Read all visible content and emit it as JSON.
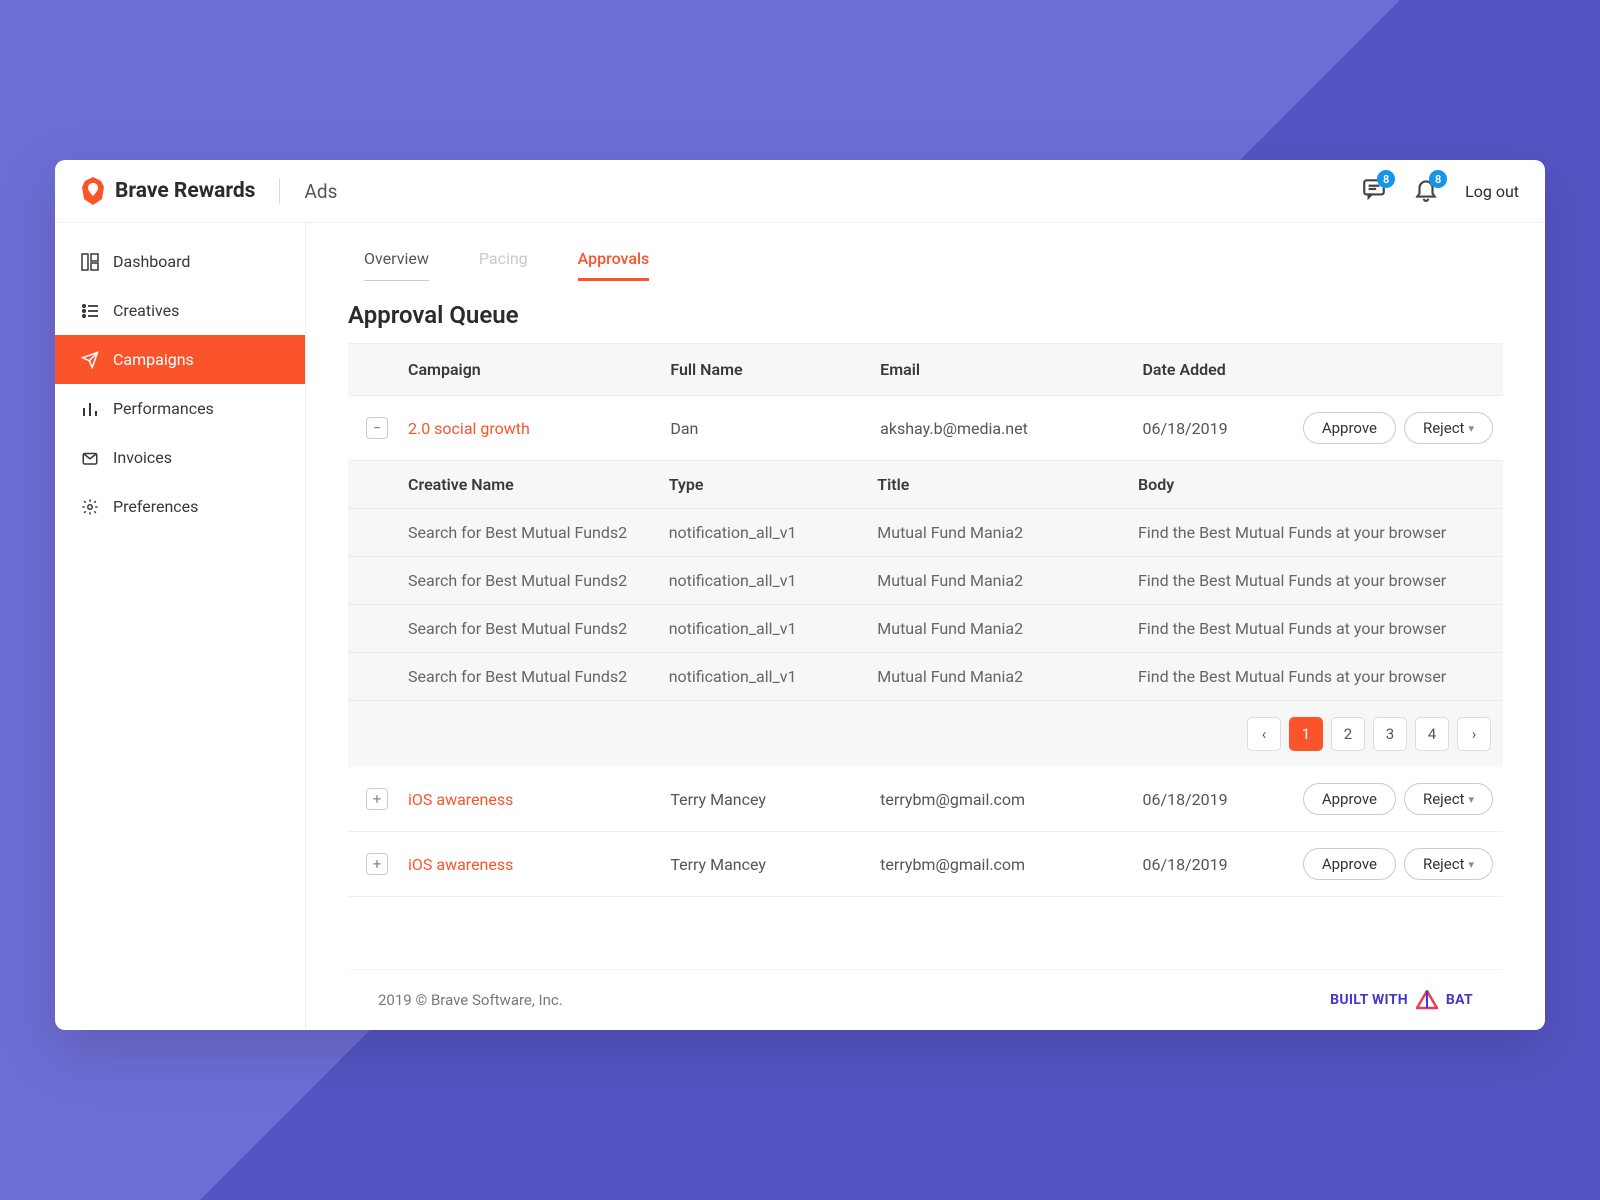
{
  "header": {
    "brand_title": "Brave Rewards",
    "brand_sub": "Ads",
    "chat_badge": "8",
    "bell_badge": "8",
    "logout_label": "Log out"
  },
  "sidebar": {
    "items": [
      {
        "label": "Dashboard"
      },
      {
        "label": "Creatives"
      },
      {
        "label": "Campaigns"
      },
      {
        "label": "Performances"
      },
      {
        "label": "Invoices"
      },
      {
        "label": "Preferences"
      }
    ]
  },
  "tabs": {
    "overview": "Overview",
    "pacing": "Pacing",
    "approvals": "Approvals"
  },
  "page_title": "Approval Queue",
  "table": {
    "headers": {
      "campaign": "Campaign",
      "full_name": "Full Name",
      "email": "Email",
      "date_added": "Date Added"
    },
    "rows": [
      {
        "expand": "−",
        "campaign": "2.0 social growth",
        "full_name": "Dan",
        "email": "akshay.b@media.net",
        "date_added": "06/18/2019"
      },
      {
        "expand": "+",
        "campaign": "iOS awareness",
        "full_name": "Terry Mancey",
        "email": "terrybm@gmail.com",
        "date_added": "06/18/2019"
      },
      {
        "expand": "+",
        "campaign": "iOS awareness",
        "full_name": "Terry Mancey",
        "email": "terrybm@gmail.com",
        "date_added": "06/18/2019"
      }
    ],
    "actions": {
      "approve": "Approve",
      "reject": "Reject"
    }
  },
  "nested": {
    "headers": {
      "creative_name": "Creative Name",
      "type": "Type",
      "title": "Title",
      "body": "Body"
    },
    "rows": [
      {
        "creative_name": "Search for Best Mutual Funds2",
        "type": "notification_all_v1",
        "title": "Mutual Fund Mania2",
        "body": "Find the Best Mutual Funds at your browser"
      },
      {
        "creative_name": "Search for Best Mutual Funds2",
        "type": "notification_all_v1",
        "title": "Mutual Fund Mania2",
        "body": "Find the Best Mutual Funds at your browser"
      },
      {
        "creative_name": "Search for Best Mutual Funds2",
        "type": "notification_all_v1",
        "title": "Mutual Fund Mania2",
        "body": "Find the Best Mutual Funds at your browser"
      },
      {
        "creative_name": "Search for Best Mutual Funds2",
        "type": "notification_all_v1",
        "title": "Mutual Fund Mania2",
        "body": "Find the Best Mutual Funds at your browser"
      }
    ],
    "pagination": {
      "prev": "‹",
      "pages": [
        "1",
        "2",
        "3",
        "4"
      ],
      "next": "›"
    }
  },
  "footer": {
    "copyright": "2019 © Brave Software, Inc.",
    "built_with": "BUILT WITH",
    "bat": "BAT"
  }
}
